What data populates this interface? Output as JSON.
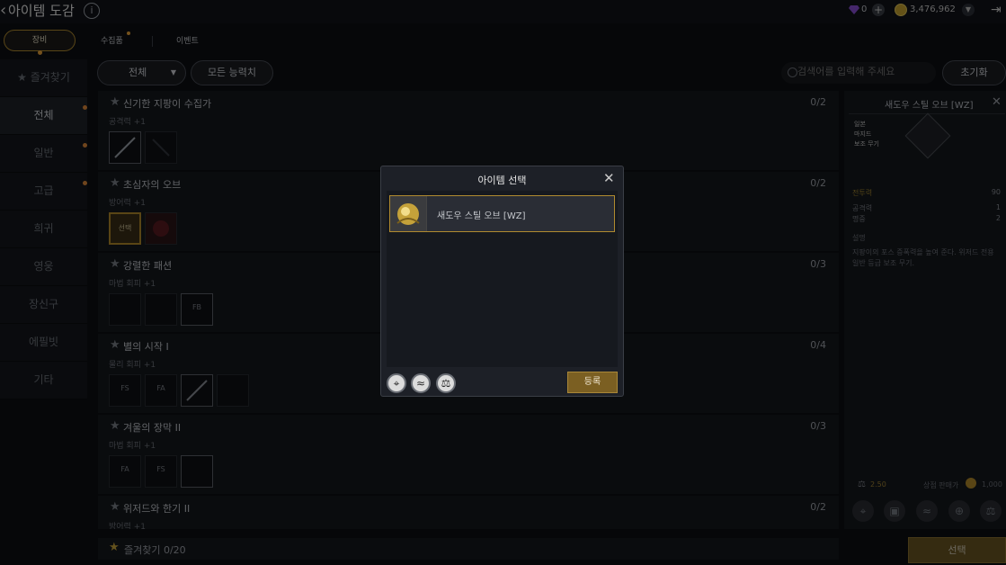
{
  "header": {
    "title": "아이템 도감",
    "info": "i",
    "gem_count": "0",
    "coin_count": "3,476,962",
    "plus": "+"
  },
  "tabs": [
    {
      "label": "장비"
    },
    {
      "label": "수집품"
    },
    {
      "label": "이벤트"
    }
  ],
  "sidebar": {
    "favorites": "즐겨찾기",
    "items": [
      {
        "label": "전체"
      },
      {
        "label": "일반"
      },
      {
        "label": "고급"
      },
      {
        "label": "희귀"
      },
      {
        "label": "영웅"
      },
      {
        "label": "장신구"
      },
      {
        "label": "에필빗"
      },
      {
        "label": "기타"
      }
    ]
  },
  "filters": {
    "all": "전체",
    "stats": "모든 능력치",
    "search_placeholder": "검색어를 입력해 주세요",
    "reset": "초기화"
  },
  "collections": [
    {
      "title": "신기한 지팡이 수집가",
      "stat": "공격력 +1",
      "progress": "0/2"
    },
    {
      "title": "초심자의 오브",
      "stat": "방어력 +1",
      "progress": "0/2",
      "slot_label": "선택"
    },
    {
      "title": "강렬한 패션",
      "stat": "마법 회피 +1",
      "progress": "0/3",
      "slot_label": "FB"
    },
    {
      "title": "별의 시작 I",
      "stat": "물리 회피 +1",
      "progress": "0/4",
      "slot_labels": [
        "FS",
        "FA"
      ]
    },
    {
      "title": "겨울의 장막 II",
      "stat": "마법 회피 +1",
      "progress": "0/3",
      "slot_labels": [
        "FA",
        "FS"
      ]
    },
    {
      "title": "위저드와 한기 II",
      "stat": "방어력 +1",
      "progress": "0/2"
    }
  ],
  "favorites_footer": "즐겨찾기 0/20",
  "detail": {
    "title": "새도우 스틸 오브 [WZ]",
    "tags": [
      "일본",
      "마지드",
      "보조 무기"
    ],
    "stats": [
      {
        "label": "전투력",
        "value": "90"
      },
      {
        "label": "공격력",
        "value": "1"
      },
      {
        "label": "명중",
        "value": "2"
      }
    ],
    "desc_title": "설명",
    "desc": "지팡이의 포스 증폭력을 높여 준다. 위저드 전용 일반 등급 보조 무기.",
    "weight": "2.50",
    "sell_label": "상점 판매가",
    "sell_value": "1,000"
  },
  "select_button": "선택",
  "modal": {
    "title": "아이템 선택",
    "item_name": "새도우 스틸 오브 [WZ]",
    "register": "등록"
  },
  "colors": {
    "accent": "#b08a2f",
    "bg": "#0d0f13",
    "panel": "#15181d"
  }
}
